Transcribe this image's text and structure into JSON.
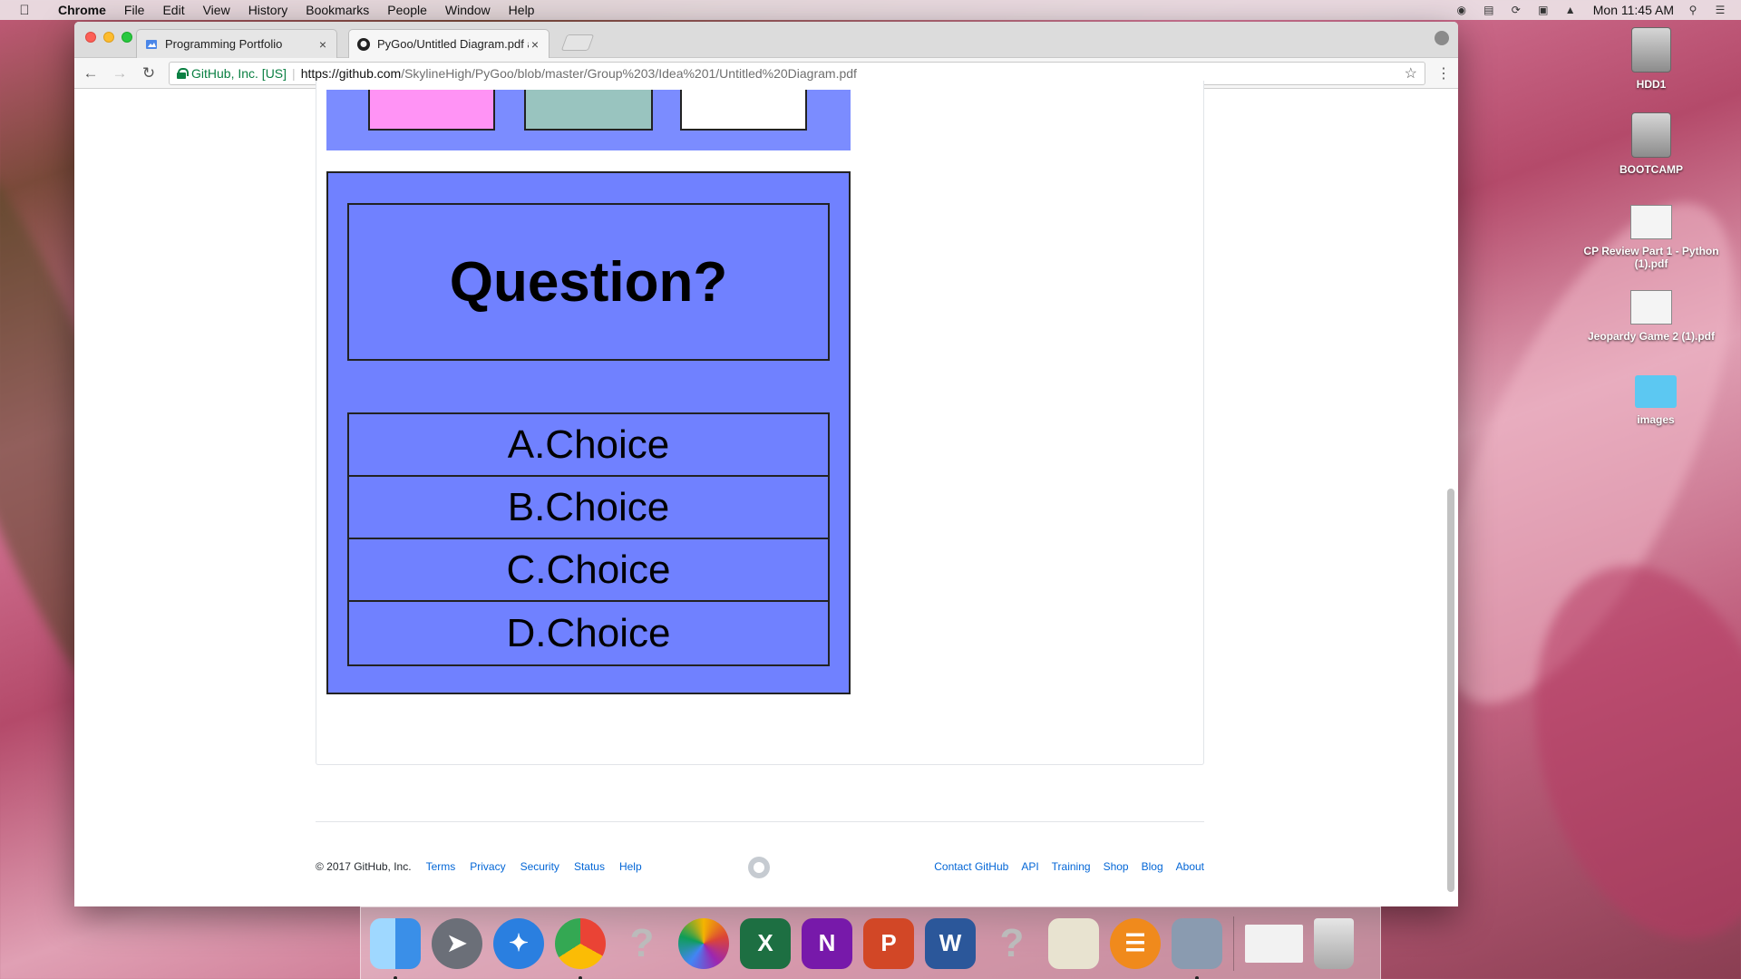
{
  "menubar": {
    "app_name": "Chrome",
    "items": [
      "File",
      "Edit",
      "View",
      "History",
      "Bookmarks",
      "People",
      "Window",
      "Help"
    ],
    "clock": "Mon 11:45 AM"
  },
  "browser": {
    "tabs": [
      {
        "title": "Programming Portfolio",
        "icon": "sites-icon",
        "active": false
      },
      {
        "title": "PyGoo/Untitled Diagram.pdf at",
        "icon": "github-icon",
        "active": true
      }
    ],
    "address": {
      "secure_label": "GitHub, Inc. [US]",
      "url_host": "https://github.com",
      "url_path": "/SkylineHigh/PyGoo/blob/master/Group%203/Idea%201/Untitled%20Diagram.pdf"
    }
  },
  "diagram": {
    "question": "Question?",
    "choices": [
      "A.Choice",
      "B.Choice",
      "C.Choice",
      "D.Choice"
    ],
    "colors": {
      "card": "#7081ff",
      "top_band": "#7b8cff",
      "swatch_pink": "#ff93f5",
      "swatch_teal": "#99c4bf",
      "swatch_white": "#ffffff"
    }
  },
  "footer": {
    "copyright": "© 2017 GitHub, Inc.",
    "left_links": [
      "Terms",
      "Privacy",
      "Security",
      "Status",
      "Help"
    ],
    "right_links": [
      "Contact GitHub",
      "API",
      "Training",
      "Shop",
      "Blog",
      "About"
    ]
  },
  "desktop": {
    "icons": [
      {
        "label": "HDD1",
        "icon": "hard-drive-icon"
      },
      {
        "label": "BOOTCAMP",
        "icon": "hard-drive-icon"
      },
      {
        "label": "CP Review Part 1 - Python (1).pdf",
        "icon": "pdf-document-icon"
      },
      {
        "label": "Jeopardy Game 2 (1).pdf",
        "icon": "pdf-document-icon"
      },
      {
        "label": "images",
        "icon": "folder-icon"
      }
    ]
  },
  "dock": {
    "apps": [
      "finder-icon",
      "launchpad-icon",
      "safari-icon",
      "chrome-icon",
      "unknown-app-icon",
      "photos-icon",
      "excel-icon",
      "onenote-icon",
      "powerpoint-icon",
      "word-icon",
      "unknown-app-icon",
      "preview-icon",
      "ibooks-icon",
      "image-capture-icon",
      "downloads-stack-icon",
      "trash-icon"
    ]
  }
}
